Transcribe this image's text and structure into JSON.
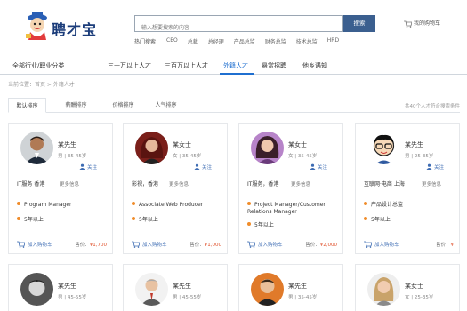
{
  "header": {
    "logo_text": "聘才宝",
    "search_placeholder": "输入想要搜索的内容",
    "search_button": "搜索",
    "cart_label": "我的购物车",
    "hot_label": "热门搜索：",
    "hot_keywords": [
      "CEO",
      "总裁",
      "总经理",
      "产品总监",
      "财务总监",
      "技术总监",
      "HRD"
    ]
  },
  "nav": {
    "items": [
      "全部行业/职业分类",
      "三十万以上人才",
      "三百万以上人才",
      "外籍人才",
      "悬赏招聘",
      "他乡遇知"
    ],
    "active": "外籍人才"
  },
  "breadcrumb": "当前位置：首页 > 外籍人才",
  "tabs": {
    "items": [
      "默认排序",
      "薪酬排序",
      "价格排序",
      "人气排序"
    ],
    "active": "默认排序",
    "count_text": "共40个人才符合搜索条件"
  },
  "cards": [
    {
      "name": "某先生",
      "meta": "男 | 35-45岁",
      "follow": "关注",
      "field": "IT服务  香港",
      "more": "更多信息",
      "position": "Program Manager",
      "years": "5年以上",
      "addcart": "加入购物车",
      "price_label": "售价：",
      "price": "¥1,700"
    },
    {
      "name": "某女士",
      "meta": "女 | 35-45岁",
      "follow": "关注",
      "field": "影视，香港",
      "more": "更多信息",
      "position": "Associate Web Producer",
      "years": "5年以上",
      "addcart": "加入购物车",
      "price_label": "售价：",
      "price": "¥1,000"
    },
    {
      "name": "某女士",
      "meta": "女 | 35-45岁",
      "follow": "关注",
      "field": "IT服务，香港",
      "more": "更多信息",
      "position": "Project Manager/Customer Relations Manager",
      "years": "5年以上",
      "addcart": "加入购物车",
      "price_label": "售价：",
      "price": "¥2,000"
    },
    {
      "name": "某先生",
      "meta": "男 | 25-35岁",
      "follow": "关注",
      "field": "互联网·电商  上海",
      "more": "更多信息",
      "position": "产品设计总监",
      "years": "5年以上",
      "addcart": "加入购物车",
      "price_label": "售价：",
      "price": "¥"
    }
  ],
  "cards_row2": [
    {
      "name": "某先生",
      "meta": "男 | 45-55岁"
    },
    {
      "name": "某先生",
      "meta": "男 | 45-55岁"
    },
    {
      "name": "某先生",
      "meta": "男 | 35-45岁"
    },
    {
      "name": "某女士",
      "meta": "女 | 25-35岁"
    }
  ],
  "colors": {
    "accent": "#1f6fd0",
    "search_button": "#3b5f8f",
    "price": "#e0502a",
    "bullet": "#f08c2a",
    "logo": "#1b3c7a"
  }
}
